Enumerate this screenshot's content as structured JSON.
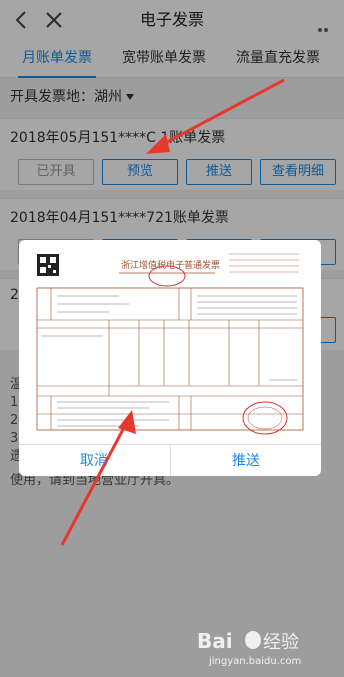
{
  "header": {
    "title": "电子发票",
    "back_icon": "chevron-left-icon",
    "close_icon": "close-icon",
    "more_icon": "more-icon"
  },
  "tabs": [
    {
      "label": "月账单发票",
      "active": true
    },
    {
      "label": "宽带账单发票",
      "active": false
    },
    {
      "label": "流量直充发票",
      "active": false
    }
  ],
  "location": {
    "label": "开具发票地：",
    "value": "湖州"
  },
  "invoices": [
    {
      "title": "2018年05月151****C  1账单发票",
      "buttons": {
        "issued": "已开具",
        "preview": "预览",
        "push": "推送",
        "detail": "查看明细"
      }
    },
    {
      "title": "2018年04月151****721账单发票",
      "buttons": {
        "issued": "",
        "preview": "",
        "push": "",
        "detail": ""
      }
    },
    {
      "title": "2"
    }
  ],
  "notes": {
    "line1": "温",
    "line2": "1",
    "line3": "2",
    "line4": "3",
    "line5": "遗",
    "last": "使用，请到当地营业厅开具。"
  },
  "dialog": {
    "invoice_title": "浙江增值税电子普通发票",
    "cancel": "取消",
    "push": "推送"
  },
  "watermark": {
    "brand": "Bai",
    "brand2": "经验",
    "url": "jingyan.baidu.com"
  }
}
